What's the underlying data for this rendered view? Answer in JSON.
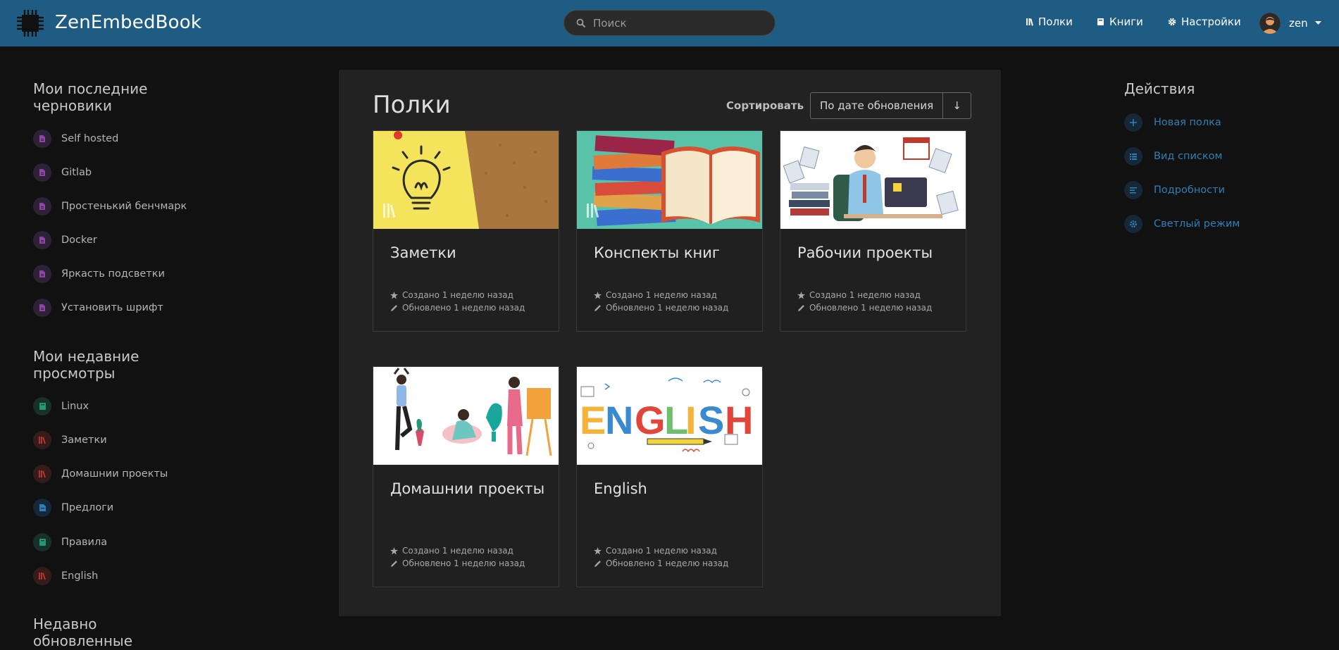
{
  "header": {
    "app_title": "ZenEmbedBook",
    "search_placeholder": "Поиск",
    "nav": [
      {
        "label": "Полки",
        "icon": "shelves-icon"
      },
      {
        "label": "Книги",
        "icon": "book-icon"
      },
      {
        "label": "Настройки",
        "icon": "gear-icon"
      }
    ],
    "user_name": "zen"
  },
  "left": {
    "drafts_title": "Мои последние черновики",
    "drafts": [
      {
        "label": "Self hosted"
      },
      {
        "label": "Gitlab"
      },
      {
        "label": "Простенький бенчмарк"
      },
      {
        "label": "Docker"
      },
      {
        "label": "Яркасть подсветки"
      },
      {
        "label": "Установить шрифт"
      }
    ],
    "views_title": "Мои недавние просмотры",
    "views": [
      {
        "label": "Linux",
        "type": "book",
        "color": "#1f9a73"
      },
      {
        "label": "Заметки",
        "type": "shelf",
        "color": "#c0392b"
      },
      {
        "label": "Домашнии проекты",
        "type": "shelf",
        "color": "#c0392b"
      },
      {
        "label": "Предлоги",
        "type": "chapter",
        "color": "#2f7fb6"
      },
      {
        "label": "Правила",
        "type": "book",
        "color": "#1f9a73"
      },
      {
        "label": "English",
        "type": "shelf",
        "color": "#c0392b"
      }
    ],
    "updated_title": "Недавно обновленные страницы"
  },
  "main": {
    "title": "Полки",
    "sort_label": "Сортировать",
    "sort_value": "По дате обновления",
    "sort_dir": "↓",
    "shelves": [
      {
        "title": "Заметки",
        "created": "Создано 1 неделю назад",
        "updated": "Обновлено 1 неделю назад"
      },
      {
        "title": "Конспекты книг",
        "created": "Создано 1 неделю назад",
        "updated": "Обновлено 1 неделю назад"
      },
      {
        "title": "Рабочии проекты",
        "created": "Создано 1 неделю назад",
        "updated": "Обновлено 1 неделю назад"
      },
      {
        "title": "Домашнии проекты",
        "created": "Создано 1 неделю назад",
        "updated": "Обновлено 1 неделю назад"
      },
      {
        "title": "English",
        "created": "Создано 1 неделю назад",
        "updated": "Обновлено 1 неделю назад"
      }
    ]
  },
  "right": {
    "title": "Действия",
    "actions": [
      {
        "label": "Новая полка",
        "icon": "plus-icon"
      },
      {
        "label": "Вид списком",
        "icon": "list-icon"
      },
      {
        "label": "Подробности",
        "icon": "details-icon"
      },
      {
        "label": "Светлый режим",
        "icon": "sun-icon"
      }
    ]
  },
  "colors": {
    "header_bg": "#1e5c84",
    "page_bg": "#111111",
    "panel_bg": "#222222",
    "link": "#2f7fb6",
    "page_icon": "#8e44ad"
  }
}
